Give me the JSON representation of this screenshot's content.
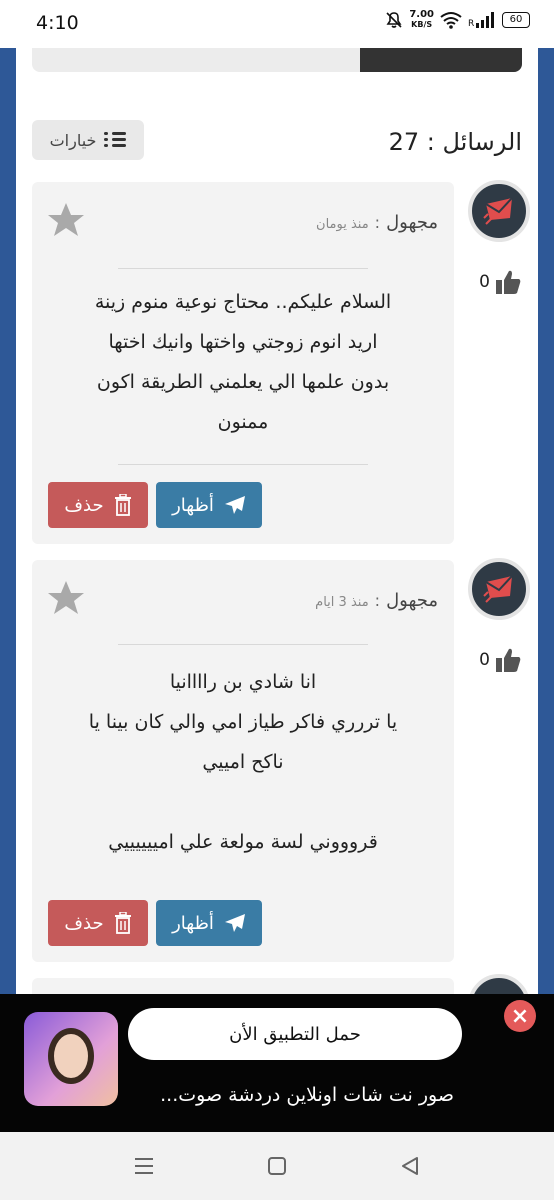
{
  "status_bar": {
    "time": "4:10",
    "speed_value": "7.00",
    "speed_unit": "KB/S",
    "battery": "60"
  },
  "header": {
    "messages_count": "الرسائل : 27",
    "options_label": "خيارات"
  },
  "messages": [
    {
      "author": "مجهول",
      "separator": ":",
      "time": "منذ يومان",
      "body": "السلام عليكم.. محتاج نوعية منوم زينة\nاريد انوم زوجتي واختها وانيك اختها\nبدون علمها الي يعلمني الطريقة اكون\nممنون",
      "likes": "0",
      "show_label": "أظهار",
      "delete_label": "حذف"
    },
    {
      "author": "مجهول",
      "separator": ":",
      "time": "منذ 3 ايام",
      "body": "انا شادي بن راااانيا\nيا تررري فاكر طياز امي والي كان بينا يا\nناكح امييي\n\nقروووني لسة مولعة علي امييييييي",
      "likes": "0",
      "show_label": "أظهار",
      "delete_label": "حذف"
    }
  ],
  "ad": {
    "download_label": "حمل التطبيق الأن",
    "description": "صور نت شات اونلاين دردشة صوت...",
    "close_label": "×"
  },
  "colors": {
    "page_bg": "#2e5897",
    "show_button": "#3a7ca5",
    "delete_button": "#c55a5a",
    "avatar_accent": "#e04d4d"
  }
}
